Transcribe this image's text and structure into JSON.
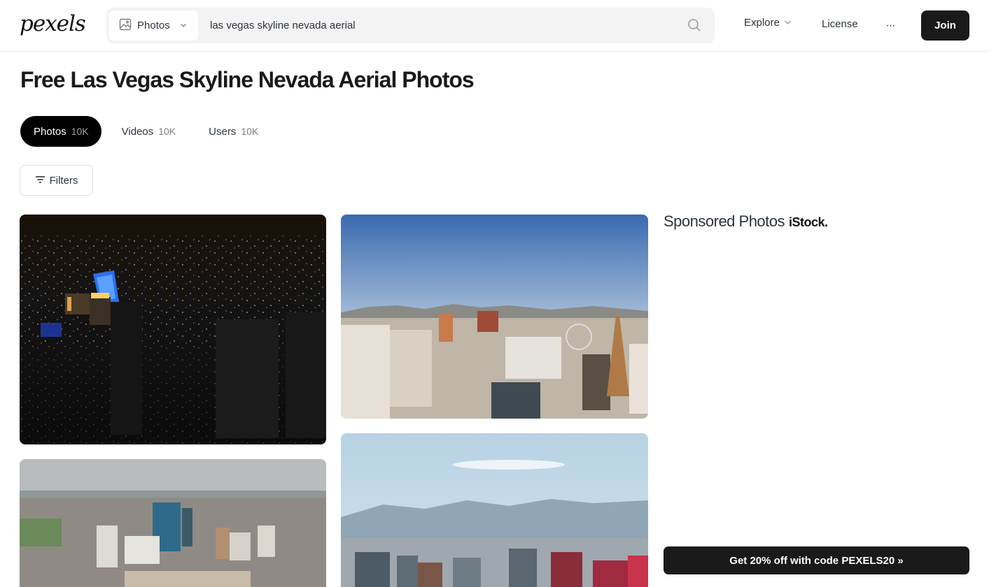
{
  "header": {
    "logo": "pexels",
    "search": {
      "type_label": "Photos",
      "query": "las vegas skyline nevada aerial"
    },
    "nav": {
      "explore": "Explore",
      "license": "License",
      "more": "···",
      "join": "Join"
    }
  },
  "page": {
    "title": "Free Las Vegas Skyline Nevada Aerial Photos"
  },
  "tabs": [
    {
      "label": "Photos",
      "count": "10K",
      "active": true
    },
    {
      "label": "Videos",
      "count": "10K",
      "active": false
    },
    {
      "label": "Users",
      "count": "10K",
      "active": false
    }
  ],
  "filters": {
    "label": "Filters"
  },
  "photos": [
    {
      "subject": "night-aerial-city-lights"
    },
    {
      "subject": "day-strip-skyline-mountains"
    },
    {
      "subject": "aerial-city-towers-overcast"
    },
    {
      "subject": "skyline-mountains-blue-sky"
    }
  ],
  "sponsored": {
    "title": "Sponsored Photos",
    "brand": "iStock.",
    "promo": "Get 20% off with code PEXELS20 »"
  },
  "colors": {
    "dark_button": "#1a1a1a",
    "search_bg": "#f3f3f3",
    "text": "#2c343e"
  }
}
